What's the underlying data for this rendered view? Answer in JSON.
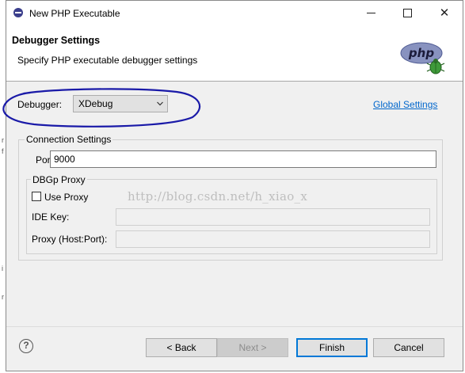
{
  "window": {
    "title": "New PHP Executable",
    "app_icon": "eclipse-icon",
    "controls": [
      "minimize-icon",
      "maximize-icon",
      "close-icon"
    ]
  },
  "header": {
    "title": "Debugger Settings",
    "subtitle": "Specify PHP executable debugger settings",
    "logo_text": "php"
  },
  "debugger": {
    "label": "Debugger:",
    "selected": "XDebug",
    "global_settings_link": "Global Settings"
  },
  "connection": {
    "group_title": "Connection Settings",
    "port_label": "Port:",
    "port_value": "9000",
    "dbgp": {
      "group_title": "DBGp Proxy",
      "use_proxy_label": "Use Proxy",
      "use_proxy_checked": false,
      "ide_key_label": "IDE Key:",
      "ide_key_value": "",
      "proxy_label": "Proxy (Host:Port):",
      "proxy_value": ""
    }
  },
  "watermark": "http://blog.csdn.net/h_xiao_x",
  "footer": {
    "back": "< Back",
    "next": "Next >",
    "finish": "Finish",
    "cancel": "Cancel"
  },
  "colors": {
    "accent": "#0078d7",
    "link": "#0066cc",
    "annotation": "#1a1aa8",
    "php_logo": "#8892bf"
  }
}
